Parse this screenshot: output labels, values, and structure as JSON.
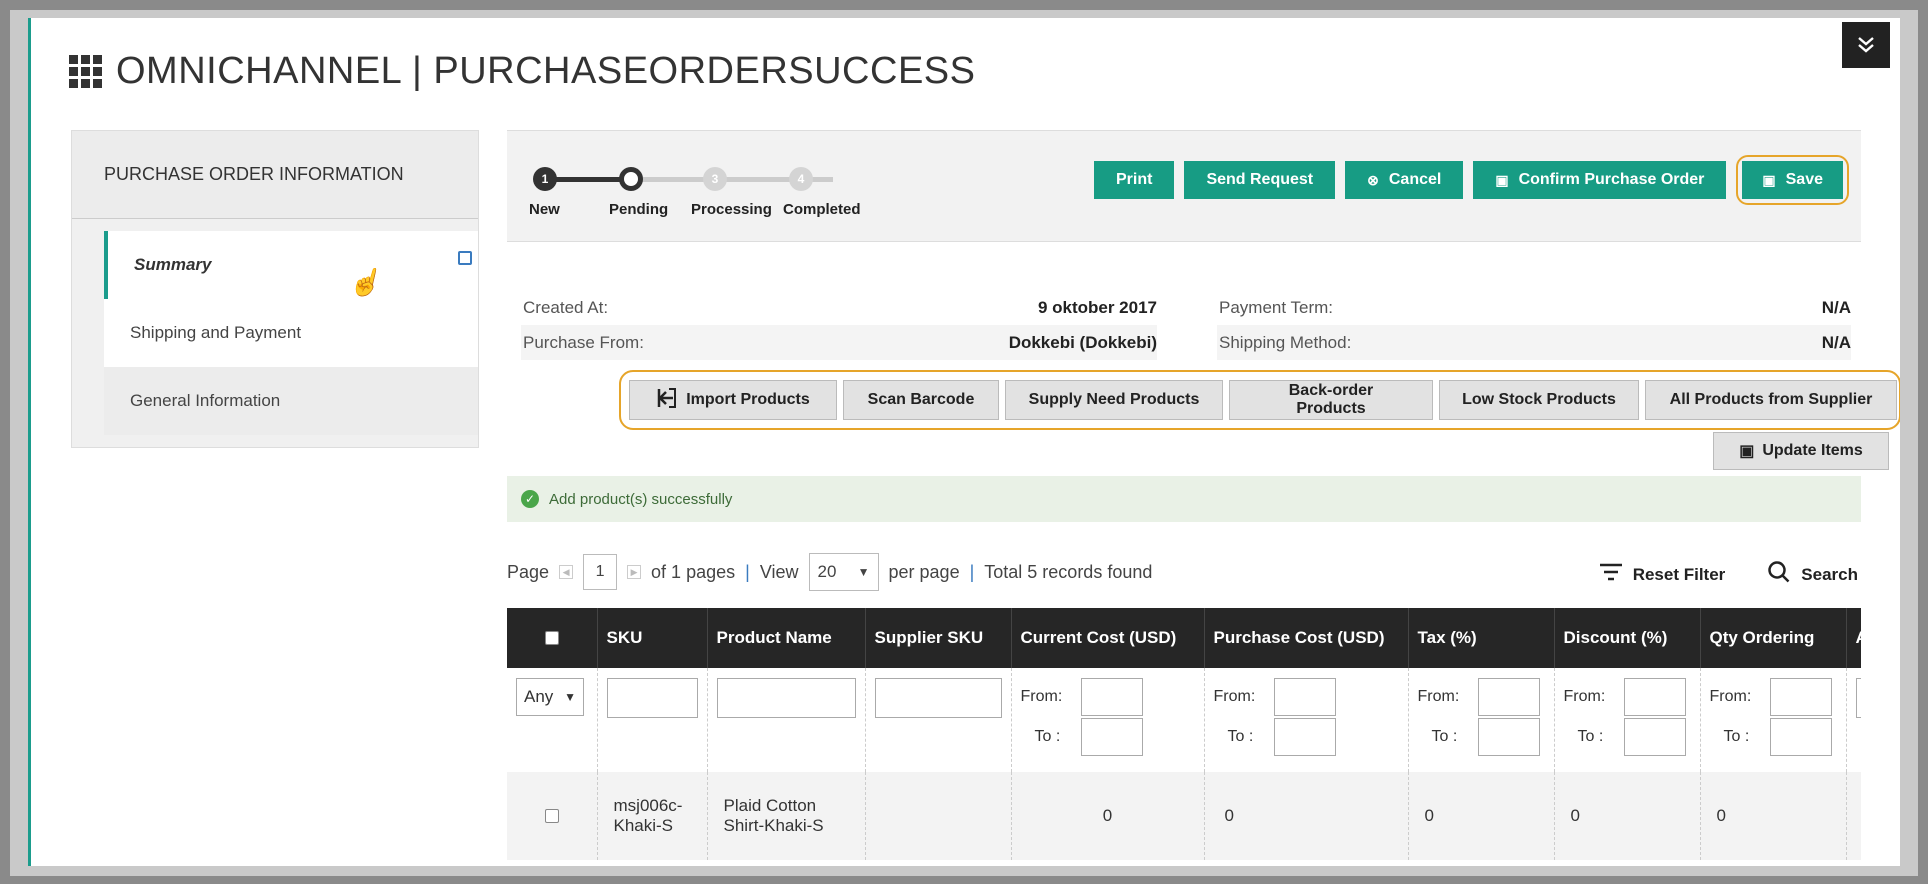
{
  "header": {
    "title": "OMNICHANNEL | PURCHASEORDERSUCCESS",
    "collapse_icon": "double-chevron-down-icon"
  },
  "sidebar": {
    "heading": "PURCHASE ORDER INFORMATION",
    "items": [
      {
        "label": "Summary"
      },
      {
        "label": "Shipping and Payment"
      },
      {
        "label": "General Information"
      }
    ]
  },
  "steps": [
    {
      "number": "1",
      "label": "New"
    },
    {
      "number": "",
      "label": "Pending"
    },
    {
      "number": "3",
      "label": "Processing"
    },
    {
      "number": "4",
      "label": "Completed"
    }
  ],
  "actions": {
    "print": "Print",
    "send_request": "Send Request",
    "cancel": "Cancel",
    "confirm": "Confirm Purchase Order",
    "save": "Save"
  },
  "info": {
    "created_at_label": "Created At:",
    "created_at_value": "9 oktober 2017",
    "purchase_from_label": "Purchase From:",
    "purchase_from_value": "Dokkebi (Dokkebi)",
    "payment_term_label": "Payment Term:",
    "payment_term_value": "N/A",
    "shipping_method_label": "Shipping Method:",
    "shipping_method_value": "N/A"
  },
  "product_buttons": {
    "import": "Import Products",
    "scan": "Scan Barcode",
    "supply_need": "Supply Need Products",
    "backorder": "Back-order Products",
    "low_stock": "Low Stock Products",
    "all_supplier": "All Products from Supplier",
    "update_items": "Update Items"
  },
  "message": {
    "text": "Add product(s) successfully"
  },
  "pager": {
    "page_label": "Page",
    "page_value": "1",
    "of_pages": "of 1 pages",
    "view_label": "View",
    "view_value": "20",
    "per_page": "per page",
    "total": "Total 5 records found",
    "reset_filter": "Reset Filter",
    "search": "Search"
  },
  "table": {
    "columns": [
      "SKU",
      "Product Name",
      "Supplier SKU",
      "Current Cost (USD)",
      "Purchase Cost (USD)",
      "Tax (%)",
      "Discount (%)",
      "Qty Ordering",
      "A"
    ],
    "any_option": "Any",
    "from_label": "From:",
    "to_label": "To :",
    "rows": [
      {
        "sku": "msj006c-Khaki-S",
        "name": "Plaid Cotton Shirt-Khaki-S",
        "supplier_sku": "",
        "current_cost": "0",
        "purchase_cost": "0",
        "tax": "0",
        "discount": "0",
        "qty": "0"
      }
    ]
  },
  "colors": {
    "accent": "#179c84",
    "highlight": "#e6a52a",
    "header_dark": "#262626"
  }
}
